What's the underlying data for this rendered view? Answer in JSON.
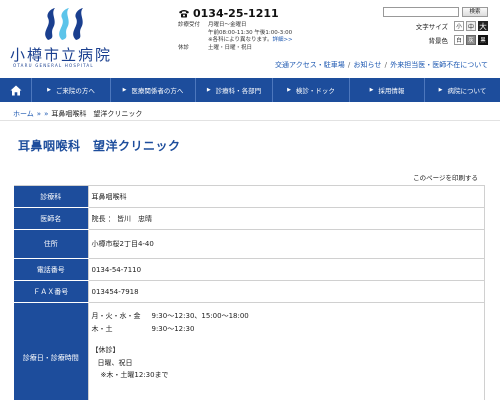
{
  "logo": {
    "name": "小樽市立病院",
    "en": "OTARU GENERAL HOSPITAL",
    "colors": {
      "primary": "#1a3f8f",
      "accent": "#5cc4ea"
    }
  },
  "contact": {
    "phone": "0134-25-1211",
    "reception_label": "診療受付",
    "reception_days": "月曜日～金曜日",
    "reception_time": "午前08:00-11:30 午後1:00-3:00",
    "note": "※各科により異なります。",
    "detail_link": "詳細>>",
    "closed_label": "休診",
    "closed_days": "土曜・日曜・祝日"
  },
  "util": {
    "search_placeholder": "",
    "search_button": "検索",
    "font_size_label": "文字サイズ",
    "font_sizes": [
      "小",
      "中",
      "大"
    ],
    "bg_color_label": "背景色",
    "bg_colors": [
      "白",
      "灰",
      "黒"
    ]
  },
  "sub_links": [
    "交通アクセス・駐車場",
    "お知らせ",
    "外来担当医・医師不在について"
  ],
  "nav": {
    "home_icon": "home-icon",
    "items": [
      "ご来院の方へ",
      "医療関係者の方へ",
      "診療科・各部門",
      "検診・ドック",
      "採用情報",
      "病院について"
    ],
    "color": "#1d4d9c"
  },
  "breadcrumb": {
    "home": "ホーム",
    "sep1": "»",
    "sep2": "»",
    "current": "耳鼻咽喉科　望洋クリニック"
  },
  "page": {
    "title": "耳鼻咽喉科　望洋クリニック",
    "print": "このページを印刷する"
  },
  "info": {
    "rows": [
      {
        "label": "診療科",
        "value": "耳鼻咽喉科"
      },
      {
        "label": "医師名",
        "value": "院長 ： 皆川　忠晴"
      },
      {
        "label": "住所",
        "value": "小樽市桜2丁目4-40"
      },
      {
        "label": "電話番号",
        "value": "0134-54-7110"
      },
      {
        "label": "ＦＡＸ番号",
        "value": "013454-7918"
      }
    ],
    "schedule": {
      "label": "診療日・診療時間",
      "lines": [
        {
          "day": "月・火・水・金",
          "time": "9:30～12:30、15:00～18:00"
        },
        {
          "day": "木・土",
          "time": "9:30～12:30"
        }
      ],
      "closed_title": "【休診】",
      "closed_lines": [
        "日曜、祝日",
        "※木・土曜12:30まで"
      ]
    }
  }
}
